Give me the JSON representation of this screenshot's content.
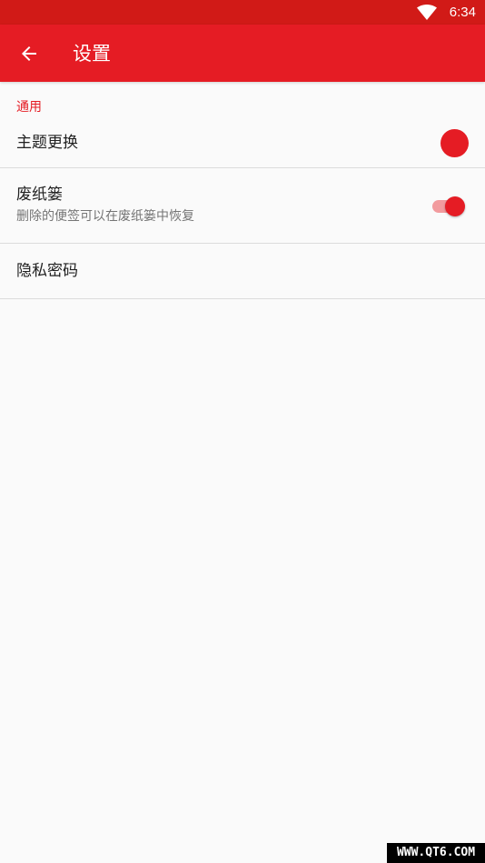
{
  "status_bar": {
    "time": "6:34",
    "wifi_icon": "wifi-icon"
  },
  "app_bar": {
    "back_icon": "arrow-back-icon",
    "title": "设置"
  },
  "settings": {
    "section_header": "通用",
    "theme": {
      "title": "主题更换",
      "color": "#e51c24"
    },
    "trash": {
      "title": "废纸篓",
      "summary": "删除的便签可以在废纸篓中恢复",
      "enabled": true
    },
    "privacy_password": {
      "title": "隐私密码"
    }
  },
  "colors": {
    "primary": "#e51c24",
    "primary_dark": "#d11a17",
    "background": "#fafafa"
  },
  "watermark": "WWW.QT6.COM"
}
